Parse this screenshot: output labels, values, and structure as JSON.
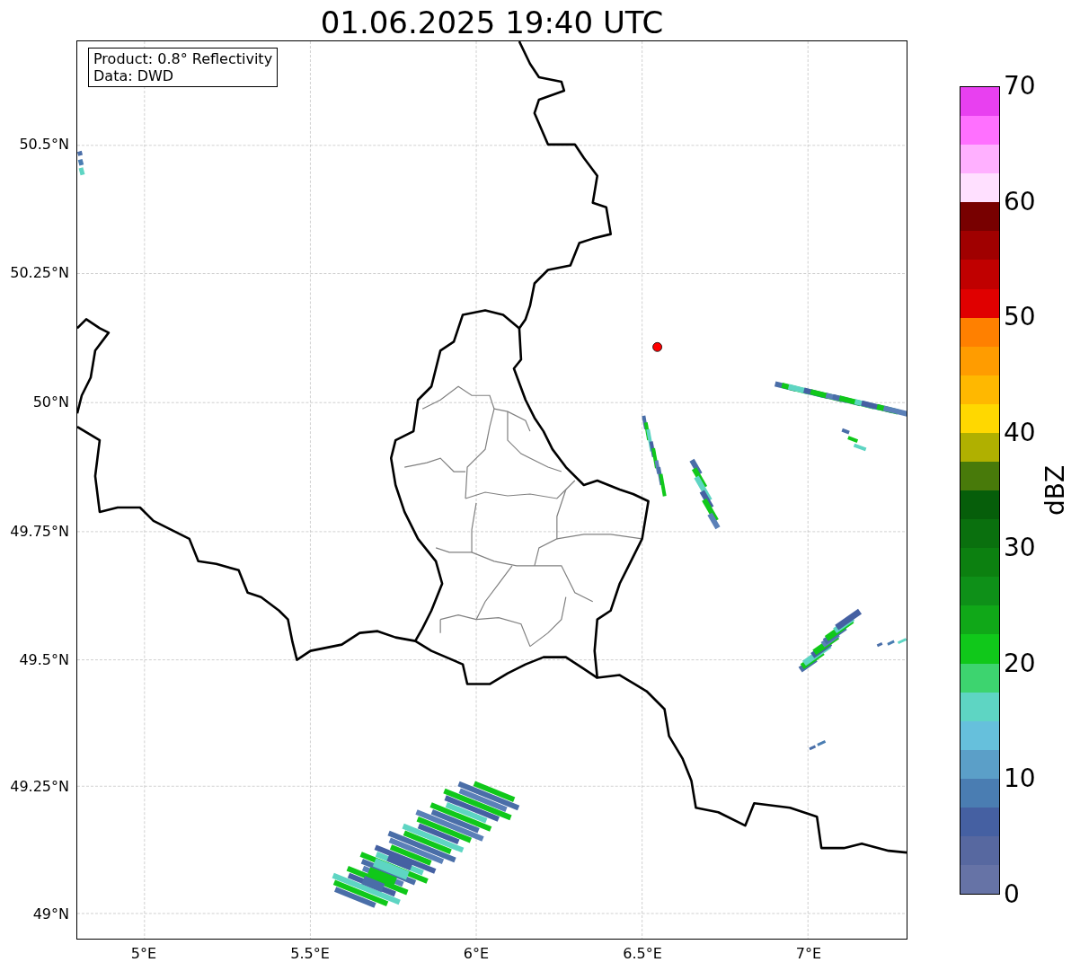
{
  "title": "01.06.2025 19:40 UTC",
  "map": {
    "info_box": [
      "Product: 0.8° Reflectivity",
      "Data: DWD"
    ],
    "lat_labels": [
      "50.5°N",
      "50.25°N",
      "50°N",
      "49.75°N",
      "49.5°N",
      "49.25°N",
      "49°N"
    ],
    "lon_labels": [
      "5°E",
      "5.5°E",
      "6°E",
      "6.5°E",
      "7°E"
    ]
  },
  "colorbar": {
    "label": "dBZ",
    "ticks": [
      "70",
      "60",
      "50",
      "40",
      "30",
      "20",
      "10",
      "0"
    ],
    "segments": [
      {
        "color": "#e840f0"
      },
      {
        "color": "#ff70ff"
      },
      {
        "color": "#ffb0ff"
      },
      {
        "color": "#ffe0ff"
      },
      {
        "color": "#780000"
      },
      {
        "color": "#a00000"
      },
      {
        "color": "#c00000"
      },
      {
        "color": "#e00000"
      },
      {
        "color": "#ff8000"
      },
      {
        "color": "#ff9c00"
      },
      {
        "color": "#ffb800"
      },
      {
        "color": "#ffd800"
      },
      {
        "color": "#b0b000"
      },
      {
        "color": "#487a0a"
      },
      {
        "color": "#065e0a"
      },
      {
        "color": "#0a700e"
      },
      {
        "color": "#0c8010"
      },
      {
        "color": "#0e9018"
      },
      {
        "color": "#10a818"
      },
      {
        "color": "#10c81a"
      },
      {
        "color": "#3dd46f"
      },
      {
        "color": "#5ed5c3"
      },
      {
        "color": "#66c0dc"
      },
      {
        "color": "#5b9fc8"
      },
      {
        "color": "#4a7db2"
      },
      {
        "color": "#4560a2"
      },
      {
        "color": "#5768a0"
      },
      {
        "color": "#6673a6"
      }
    ]
  }
}
